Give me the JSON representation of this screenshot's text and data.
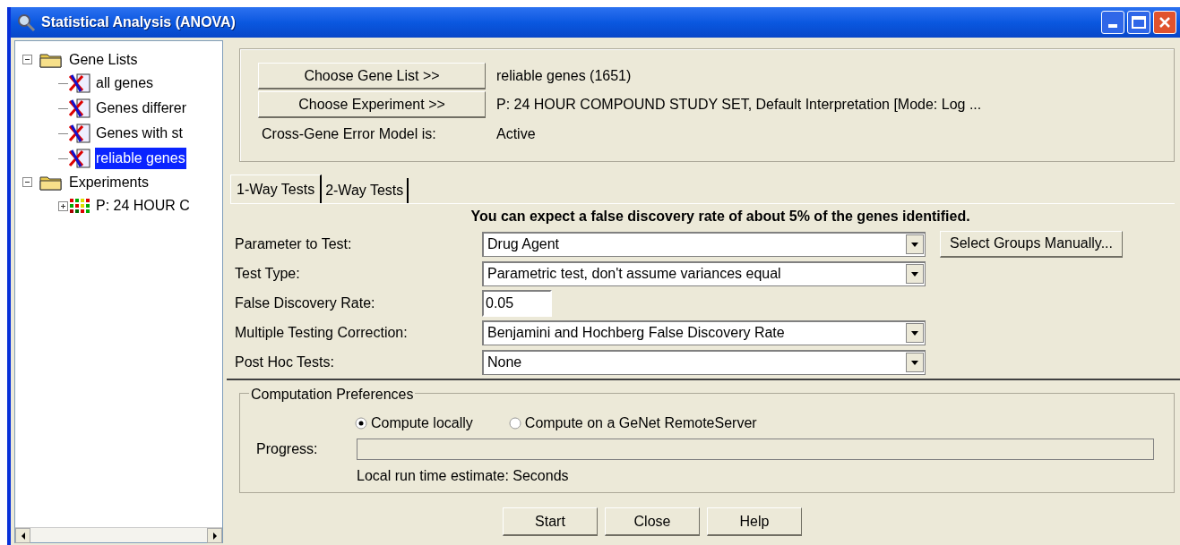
{
  "window": {
    "title": "Statistical Analysis (ANOVA)"
  },
  "tree": [
    {
      "label": "Gene Lists",
      "kind": "folder",
      "expanded": true,
      "selected": false,
      "children": [
        {
          "label": "all genes",
          "kind": "genelist",
          "selected": false
        },
        {
          "label": "Genes differer",
          "kind": "genelist",
          "selected": false
        },
        {
          "label": "Genes with st",
          "kind": "genelist",
          "selected": false
        },
        {
          "label": "reliable genes",
          "kind": "genelist",
          "selected": true
        }
      ]
    },
    {
      "label": "Experiments",
      "kind": "folder",
      "expanded": true,
      "selected": false,
      "children": [
        {
          "label": "P: 24 HOUR C",
          "kind": "experiment",
          "expanded": false,
          "selected": false
        }
      ]
    }
  ],
  "selection": {
    "gene_list_button": "Choose Gene List >>",
    "gene_list": "reliable genes (1651)",
    "experiment_button": "Choose Experiment >>",
    "experiment": "P: 24 HOUR COMPOUND STUDY SET, Default Interpretation [Mode: Log ...",
    "error_model_label": "Cross-Gene Error Model is:",
    "error_model": "Active"
  },
  "tabs": [
    {
      "label": "1-Way Tests",
      "selected": true
    },
    {
      "label": "2-Way Tests",
      "selected": false
    }
  ],
  "notice": "You can expect a false discovery rate of about 5% of the genes identified.",
  "fields": [
    {
      "label": "Parameter to Test:",
      "kind": "dropdown",
      "value": "Drug Agent",
      "button": "Select Groups Manually..."
    },
    {
      "label": "Test Type:",
      "kind": "dropdown",
      "value": "Parametric test, don't assume variances equal"
    },
    {
      "label": "False Discovery Rate:",
      "kind": "text",
      "value": "0.05"
    },
    {
      "label": "Multiple Testing Correction:",
      "kind": "dropdown",
      "value": "Benjamini and Hochberg False Discovery Rate"
    },
    {
      "label": "Post Hoc Tests:",
      "kind": "dropdown",
      "value": "None"
    }
  ],
  "computation": {
    "title": "Computation Preferences",
    "options": [
      {
        "label": "Compute locally",
        "selected": true
      },
      {
        "label": "Compute on a GeNet RemoteServer",
        "selected": false
      }
    ],
    "progress_label": "Progress:",
    "progress": {
      "level": 0
    },
    "estimate": "Local run time estimate: Seconds"
  },
  "buttons": [
    "Start",
    "Close",
    "Help"
  ]
}
